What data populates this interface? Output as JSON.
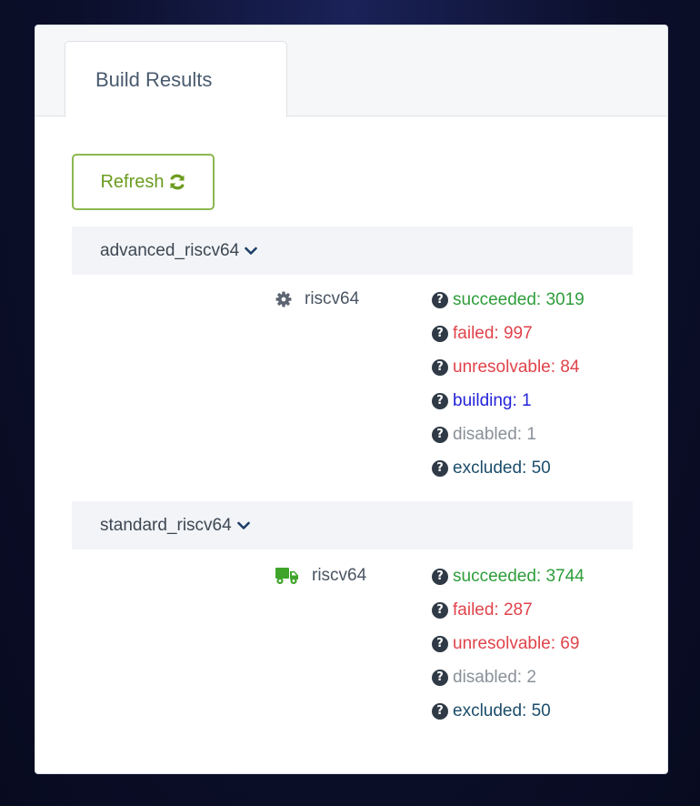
{
  "colors": {
    "succeeded": "#2e9d3a",
    "failed": "#e0434b",
    "unresolvable": "#e0434b",
    "building": "#2323d8",
    "disabled": "#8a9099",
    "excluded": "#1c4d6b",
    "refresh": "#6b9c1f",
    "truck": "#3fa52a",
    "gear": "#5b6470"
  },
  "tabs": [
    {
      "label": "Build Results"
    }
  ],
  "refresh": {
    "label": "Refresh",
    "icon": "refresh-icon"
  },
  "repositories": [
    {
      "name": "advanced_riscv64",
      "arch": {
        "label": "riscv64",
        "icon": "gear-icon"
      },
      "statuses": [
        {
          "key": "succeeded",
          "text": "succeeded: 3019"
        },
        {
          "key": "failed",
          "text": "failed: 997"
        },
        {
          "key": "unresolvable",
          "text": "unresolvable: 84"
        },
        {
          "key": "building",
          "text": "building: 1"
        },
        {
          "key": "disabled",
          "text": "disabled: 1"
        },
        {
          "key": "excluded",
          "text": "excluded: 50"
        }
      ]
    },
    {
      "name": "standard_riscv64",
      "arch": {
        "label": "riscv64",
        "icon": "truck-icon"
      },
      "statuses": [
        {
          "key": "succeeded",
          "text": "succeeded: 3744"
        },
        {
          "key": "failed",
          "text": "failed: 287"
        },
        {
          "key": "unresolvable",
          "text": "unresolvable: 69"
        },
        {
          "key": "disabled",
          "text": "disabled: 2"
        },
        {
          "key": "excluded",
          "text": "excluded: 50"
        }
      ]
    }
  ]
}
